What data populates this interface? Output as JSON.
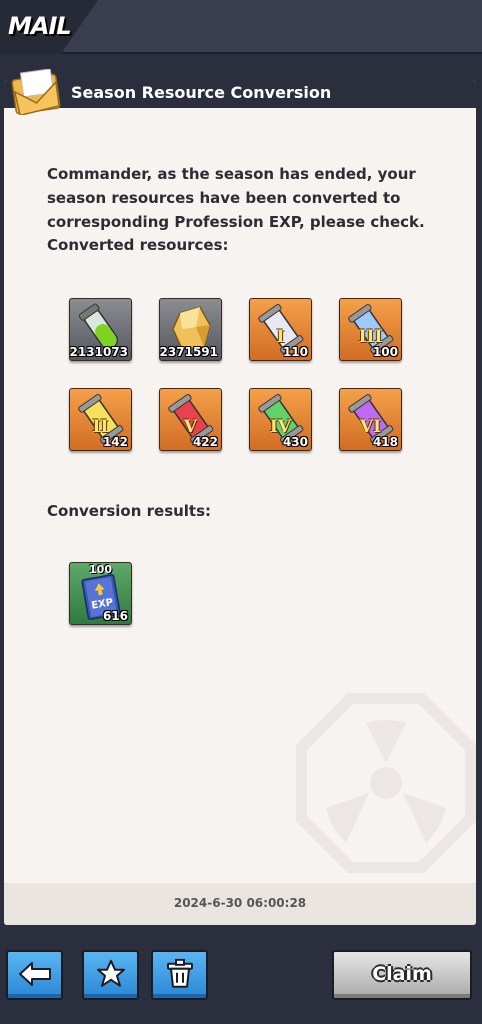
{
  "header": {
    "title": "MAIL"
  },
  "mail": {
    "title": "Season Resource Conversion",
    "message": "Commander, as the season has ended, your season resources have been converted to corresponding Profession EXP, please check.",
    "converted_label": "Converted resources:",
    "results_label": "Conversion results:",
    "converted_resources": [
      {
        "icon": "green-vial-icon",
        "count": "2131073"
      },
      {
        "icon": "gold-crystal-icon",
        "count": "2371591"
      },
      {
        "icon": "white-scroll-icon",
        "tier": "I",
        "count": "110"
      },
      {
        "icon": "blue-scroll-icon",
        "tier": "III",
        "count": "100"
      },
      {
        "icon": "yellow-scroll-icon",
        "tier": "II",
        "count": "142"
      },
      {
        "icon": "red-scroll-icon",
        "tier": "V",
        "count": "422"
      },
      {
        "icon": "green-scroll-icon",
        "tier": "IV",
        "count": "430"
      },
      {
        "icon": "purple-scroll-icon",
        "tier": "VI",
        "count": "418"
      }
    ],
    "results": [
      {
        "icon": "exp-book-icon",
        "top_label": "100",
        "badge": "EXP",
        "count": "616"
      }
    ],
    "timestamp": "2024-6-30 06:00:28"
  },
  "toolbar": {
    "back_icon": "back-arrow-icon",
    "favorite_icon": "star-icon",
    "delete_icon": "trash-icon",
    "claim_label": "Claim"
  },
  "colors": {
    "background": "#2b2e3c",
    "panel": "#f7f3f1",
    "button_blue": "#2c86d6",
    "item_orange": "#e5853a",
    "item_gray": "#6f7278",
    "item_green": "#3f8c4f"
  }
}
